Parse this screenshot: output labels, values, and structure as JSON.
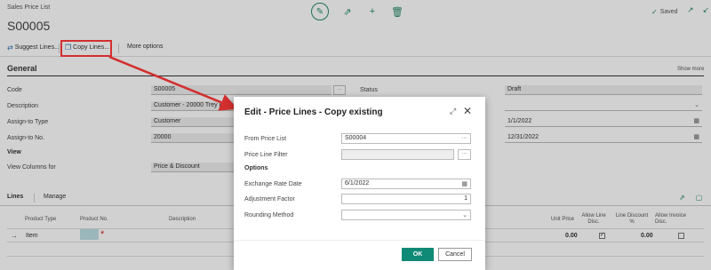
{
  "header": {
    "breadcrumb": "Sales Price List",
    "title": "S00005",
    "saved_label": "Saved",
    "icons": [
      "edit-icon",
      "share-icon",
      "add-icon",
      "delete-icon",
      "check-icon",
      "open-new-window-icon",
      "collapse-icon"
    ]
  },
  "actionbar": {
    "suggest_lines": "Suggest Lines...",
    "copy_lines": "Copy Lines...",
    "more_options": "More options"
  },
  "general": {
    "title": "General",
    "show_more": "Show more",
    "code_label": "Code",
    "code_value": "S00005",
    "description_label": "Description",
    "description_value": "Customer - 20000 Trey Research",
    "assign_to_type_label": "Assign-to Type",
    "assign_to_type_value": "Customer",
    "assign_to_no_label": "Assign-to No.",
    "assign_to_no_value": "20000",
    "view_heading": "View",
    "view_columns_label": "View Columns for",
    "view_columns_value": "Price & Discount",
    "status_label": "Status",
    "status_value": "Draft",
    "starting_date_value": "1/1/2022",
    "ending_date_value": "12/31/2022"
  },
  "lines": {
    "tab": "Lines",
    "manage": "Manage",
    "columns": {
      "product_type": "Product Type",
      "product_no": "Product No.",
      "description": "Description",
      "unit_price": "Unit Price",
      "allow_line_disc": "Allow Line Disc.",
      "line_discount_pct": "Line Discount %",
      "allow_invoice_disc": "Allow Invoice Disc."
    },
    "row": {
      "product_type": "Item",
      "unit_price": "0.00",
      "line_discount_pct": "0.00",
      "allow_line_disc_checked": true,
      "allow_invoice_disc_checked": false
    }
  },
  "dialog": {
    "title": "Edit - Price Lines - Copy existing",
    "from_price_list_label": "From Price List",
    "from_price_list_value": "S00004",
    "price_line_filter_label": "Price Line Filter",
    "options_heading": "Options",
    "exchange_rate_date_label": "Exchange Rate Date",
    "exchange_rate_date_value": "6/1/2022",
    "adjustment_factor_label": "Adjustment Factor",
    "adjustment_factor_value": "1",
    "rounding_method_label": "Rounding Method",
    "ok": "OK",
    "cancel": "Cancel"
  },
  "colors": {
    "accent": "#0f8a76",
    "highlight": "#d32f2f"
  }
}
